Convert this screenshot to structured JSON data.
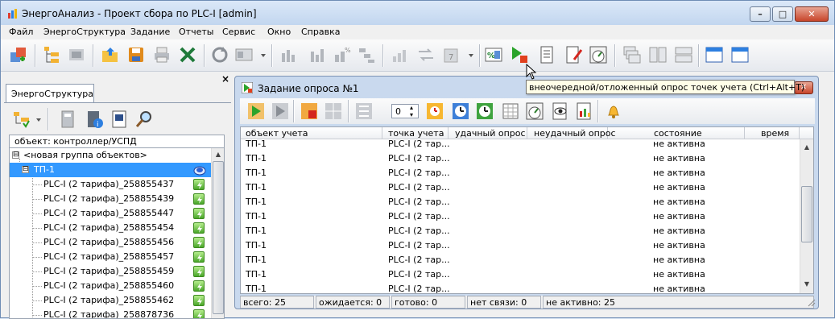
{
  "window": {
    "title": "ЭнергоАнализ - Проект сбора по PLC-I [admin]",
    "minimize": "–",
    "maximize": "□",
    "close": "✕"
  },
  "menu": [
    "Файл",
    "ЭнергоСтруктура",
    "Задание",
    "Отчеты",
    "Сервис",
    "Окно",
    "Справка"
  ],
  "left_panel": {
    "close_glyph": "×",
    "tab": "ЭнергоСтруктура",
    "column_header": "объект: контроллер/УСПД",
    "tree": [
      {
        "label": "<новая группа объектов>",
        "box": "⊟",
        "level": 0
      },
      {
        "label": "ТП-1",
        "box": "⊟",
        "level": 1,
        "selected": true
      },
      {
        "label": "PLC-I (2 тарифа)_258855437",
        "level": 2
      },
      {
        "label": "PLC-I (2 тарифа)_258855439",
        "level": 2
      },
      {
        "label": "PLC-I (2 тарифа)_258855447",
        "level": 2
      },
      {
        "label": "PLC-I (2 тарифа)_258855454",
        "level": 2
      },
      {
        "label": "PLC-I (2 тарифа)_258855456",
        "level": 2
      },
      {
        "label": "PLC-I (2 тарифа)_258855457",
        "level": 2
      },
      {
        "label": "PLC-I (2 тарифа)_258855459",
        "level": 2
      },
      {
        "label": "PLC-I (2 тарифа)_258855460",
        "level": 2
      },
      {
        "label": "PLC-I (2 тарифа)_258855462",
        "level": 2
      },
      {
        "label": "PLC-I (2 тарифа)_258878736",
        "level": 2
      }
    ]
  },
  "task_window": {
    "title": "Задание опроса  №1",
    "close": "✕",
    "spin_value": "0",
    "columns": [
      "объект учета",
      "точка учета",
      "удачный опрос",
      "неудачный опрос",
      "состояние",
      "время"
    ],
    "rows": [
      [
        "ТП-1",
        "PLC-I (2 тар...",
        "",
        "",
        "не активна",
        ""
      ],
      [
        "ТП-1",
        "PLC-I (2 тар...",
        "",
        "",
        "не активна",
        ""
      ],
      [
        "ТП-1",
        "PLC-I (2 тар...",
        "",
        "",
        "не активна",
        ""
      ],
      [
        "ТП-1",
        "PLC-I (2 тар...",
        "",
        "",
        "не активна",
        ""
      ],
      [
        "ТП-1",
        "PLC-I (2 тар...",
        "",
        "",
        "не активна",
        ""
      ],
      [
        "ТП-1",
        "PLC-I (2 тар...",
        "",
        "",
        "не активна",
        ""
      ],
      [
        "ТП-1",
        "PLC-I (2 тар...",
        "",
        "",
        "не активна",
        ""
      ],
      [
        "ТП-1",
        "PLC-I (2 тар...",
        "",
        "",
        "не активна",
        ""
      ],
      [
        "ТП-1",
        "PLC-I (2 тар...",
        "",
        "",
        "не активна",
        ""
      ],
      [
        "ТП-1",
        "PLC-I (2 тар...",
        "",
        "",
        "не активна",
        ""
      ],
      [
        "ТП-1",
        "PLC-I (2 тар...",
        "",
        "",
        "не активна",
        ""
      ]
    ],
    "status": {
      "total": "всего: 25",
      "waiting": "ожидается: 0",
      "ready": "готово: 0",
      "no_link": "нет связи: 0",
      "inactive": "не активно: 25"
    }
  },
  "tooltip": "внеочередной/отложенный опрос точек учета (Ctrl+Alt+T)",
  "colors": {
    "selection": "#3399ff",
    "titlebar": "#c2d6ef",
    "close_red": "#c7452b",
    "child_frame": "#c9d9ee"
  },
  "icons": {
    "main_toolbar": [
      "add-object-icon",
      "tree-view-icon",
      "properties-icon",
      "open-folder-icon",
      "save-icon",
      "print-icon",
      "excel-icon",
      "refresh-icon",
      "view-mode-icon",
      "bar-chart-icon",
      "bar-chart2-icon",
      "percent-chart-icon",
      "gantt-icon",
      "chart3-icon",
      "chart4-icon",
      "calendar-icon",
      "percent-icon",
      "run-poll-icon",
      "task-list-icon",
      "task-edit-icon",
      "gauge-icon",
      "cascade-icon",
      "tile-vertical-icon",
      "tile-horizontal-icon",
      "window1-icon",
      "window2-icon"
    ],
    "task_toolbar": [
      "play-icon",
      "step-icon",
      "stop-icon",
      "grid-icon",
      "calc-icon",
      "clock-sun-icon",
      "clock-blue-icon",
      "clock-green-icon",
      "table-icon",
      "meter-icon",
      "eye-icon",
      "report-icon",
      "bell-icon"
    ]
  }
}
